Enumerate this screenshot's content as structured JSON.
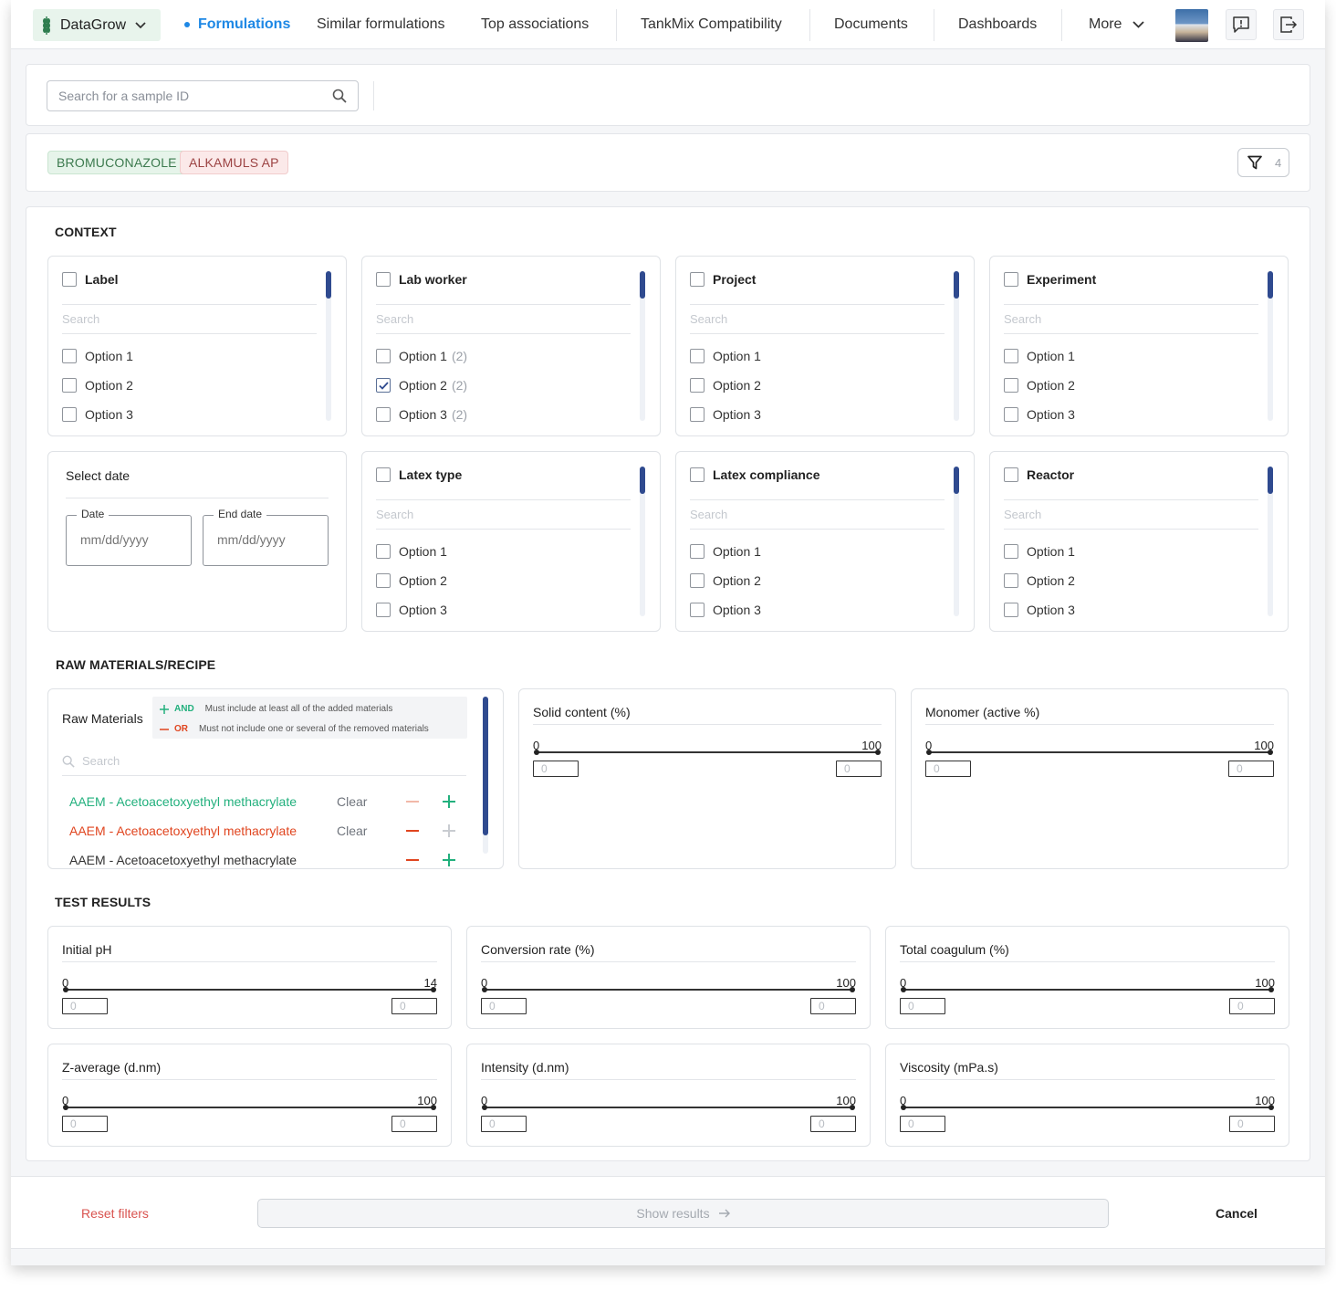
{
  "header": {
    "brand": "DataGrow",
    "nav": [
      "Formulations",
      "Similar formulations",
      "Top associations",
      "TankMix Compatibility",
      "Documents",
      "Dashboards",
      "More"
    ],
    "active": "Formulations"
  },
  "search": {
    "placeholder": "Search for a sample ID"
  },
  "tags": [
    "BROMUCONAZOLE",
    "ALKAMULS AP"
  ],
  "filter_count": "4",
  "context": {
    "title": "CONTEXT",
    "search_placeholder": "Search",
    "cards": [
      {
        "title": "Label",
        "options": [
          {
            "label": "Option 1",
            "count": ""
          },
          {
            "label": "Option 2",
            "count": ""
          },
          {
            "label": "Option 3",
            "count": ""
          }
        ]
      },
      {
        "title": "Lab worker",
        "options": [
          {
            "label": "Option 1",
            "count": "(2)"
          },
          {
            "label": "Option 2",
            "count": "(2)",
            "checked": true
          },
          {
            "label": "Option 3",
            "count": "(2)"
          }
        ]
      },
      {
        "title": "Project",
        "options": [
          {
            "label": "Option 1",
            "count": ""
          },
          {
            "label": "Option 2",
            "count": ""
          },
          {
            "label": "Option 3",
            "count": ""
          }
        ]
      },
      {
        "title": "Experiment",
        "options": [
          {
            "label": "Option 1",
            "count": ""
          },
          {
            "label": "Option 2",
            "count": ""
          },
          {
            "label": "Option 3",
            "count": ""
          }
        ]
      },
      {
        "title": "Latex type",
        "options": [
          {
            "label": "Option 1",
            "count": ""
          },
          {
            "label": "Option 2",
            "count": ""
          },
          {
            "label": "Option 3",
            "count": ""
          }
        ]
      },
      {
        "title": "Latex compliance",
        "options": [
          {
            "label": "Option 1",
            "count": ""
          },
          {
            "label": "Option 2",
            "count": ""
          },
          {
            "label": "Option 3",
            "count": ""
          }
        ]
      },
      {
        "title": "Reactor",
        "options": [
          {
            "label": "Option 1",
            "count": ""
          },
          {
            "label": "Option 2",
            "count": ""
          },
          {
            "label": "Option 3",
            "count": ""
          }
        ]
      }
    ],
    "date": {
      "title": "Select date",
      "start_label": "Date",
      "end_label": "End date",
      "placeholder": "mm/dd/yyyy"
    }
  },
  "raw": {
    "title": "RAW MATERIALS/RECIPE",
    "card_title": "Raw Materials",
    "and_label": "AND",
    "and_text": "Must include at least all of the added materials",
    "or_label": "OR",
    "or_text": "Must not include one or several of the removed materials",
    "search_placeholder": "Search",
    "clear_label": "Clear",
    "materials": [
      {
        "name": "AAEM - Acetoacetoxyethyl methacrylate",
        "state": "included",
        "clear": "Clear"
      },
      {
        "name": "AAEM - Acetoacetoxyethyl methacrylate",
        "state": "excluded",
        "clear": "Clear"
      },
      {
        "name": "AAEM - Acetoacetoxyethyl methacrylate",
        "state": "none",
        "clear": ""
      }
    ],
    "ranges": [
      {
        "title": "Solid content (%)",
        "min": "0",
        "max": "100"
      },
      {
        "title": "Monomer (active %)",
        "min": "0",
        "max": "100"
      }
    ]
  },
  "tests": {
    "title": "TEST RESULTS",
    "ranges": [
      {
        "title": "Initial pH",
        "min": "0",
        "max": "14"
      },
      {
        "title": "Conversion rate (%)",
        "min": "0",
        "max": "100"
      },
      {
        "title": "Total coagulum (%)",
        "min": "0",
        "max": "100"
      },
      {
        "title": "Z-average (d.nm)",
        "min": "0",
        "max": "100"
      },
      {
        "title": "Intensity (d.nm)",
        "min": "0",
        "max": "100"
      },
      {
        "title": "Viscosity (mPa.s)",
        "min": "0",
        "max": "100"
      }
    ],
    "input_placeholder": "0"
  },
  "footer": {
    "reset": "Reset filters",
    "show": "Show results",
    "cancel": "Cancel"
  },
  "colors": {
    "accent": "#1e88e5",
    "include": "#22b07d",
    "exclude": "#e0451f",
    "scroll": "#2f4a8f"
  }
}
